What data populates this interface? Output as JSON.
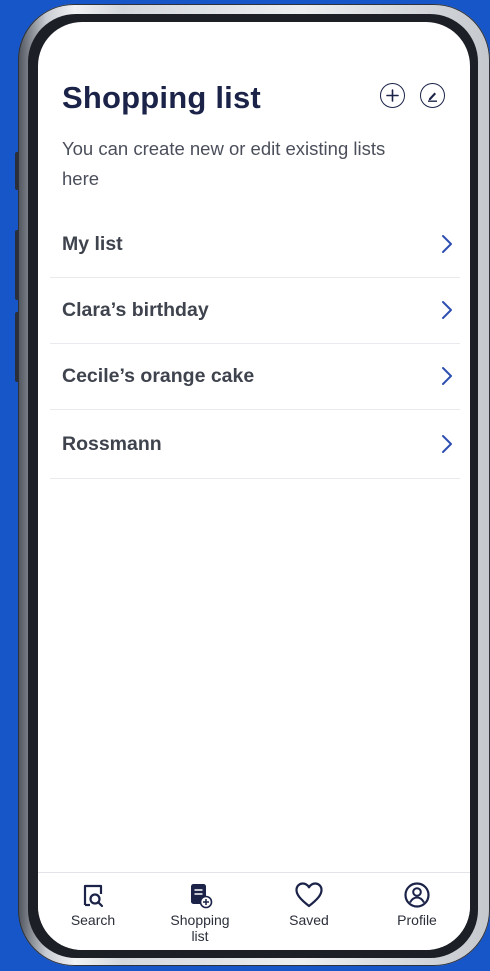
{
  "header": {
    "title": "Shopping list",
    "subtitle": "You can create new or edit existing lists here"
  },
  "lists": [
    {
      "label": "My list"
    },
    {
      "label": "Clara’s birthday"
    },
    {
      "label": "Cecile’s orange cake"
    },
    {
      "label": "Rossmann"
    }
  ],
  "tabs": [
    {
      "label": "Search",
      "icon": "search-doc-icon"
    },
    {
      "label": "Shopping list",
      "icon": "shopping-list-icon",
      "active": true
    },
    {
      "label": "Saved",
      "icon": "heart-icon"
    },
    {
      "label": "Profile",
      "icon": "profile-icon"
    }
  ],
  "colors": {
    "background": "#1656c8",
    "title": "#1b2348",
    "accent": "#2e4fb0"
  }
}
